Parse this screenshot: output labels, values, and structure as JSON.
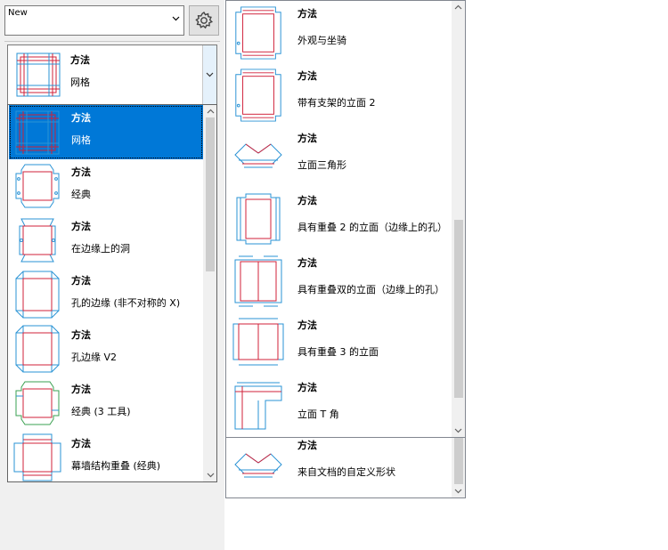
{
  "top_combo": {
    "value": "New"
  },
  "method_combo": {
    "title": "方法",
    "subtitle": "网格",
    "icon": "grid-method-thumbnail"
  },
  "dropdown": {
    "items": [
      {
        "title": "方法",
        "subtitle": "网格",
        "icon": "grid-method-thumbnail",
        "selected": true
      },
      {
        "title": "方法",
        "subtitle": "经典",
        "icon": "classic-method-thumbnail"
      },
      {
        "title": "方法",
        "subtitle": "在边缘上的洞",
        "icon": "hole-on-edge-thumbnail"
      },
      {
        "title": "方法",
        "subtitle": "孔的边缘 (非不对称的 X)",
        "icon": "hole-edge-thumbnail"
      },
      {
        "title": "方法",
        "subtitle": "孔边缘 V2",
        "icon": "hole-edge-v2-thumbnail"
      },
      {
        "title": "方法",
        "subtitle": "经典 (3 工具)",
        "icon": "classic-3-tools-thumbnail"
      },
      {
        "title": "方法",
        "subtitle": "幕墙结构重叠 (经典)",
        "icon": "curtain-overlap-thumbnail"
      }
    ]
  },
  "right_list": {
    "items": [
      {
        "title": "方法",
        "subtitle": "外观与坐骑",
        "icon": "appearance-mount-thumbnail"
      },
      {
        "title": "方法",
        "subtitle": "带有支架的立面 2",
        "icon": "facade-bracket-thumbnail"
      },
      {
        "title": "方法",
        "subtitle": "立面三角形",
        "icon": "facade-triangle-thumbnail"
      },
      {
        "title": "方法",
        "subtitle": "具有重叠 2 的立面（边缘上的孔）",
        "icon": "overlap-2-thumbnail"
      },
      {
        "title": "方法",
        "subtitle": "具有重叠双的立面（边缘上的孔）",
        "icon": "overlap-double-thumbnail"
      },
      {
        "title": "方法",
        "subtitle": "具有重叠 3 的立面",
        "icon": "overlap-3-thumbnail"
      },
      {
        "title": "方法",
        "subtitle": "立面 T 角",
        "icon": "t-corner-thumbnail"
      }
    ]
  },
  "bottom_list": {
    "item": {
      "title": "方法",
      "subtitle": "来自文档的自定义形状",
      "icon": "custom-shape-thumbnail"
    }
  },
  "colors": {
    "selection": "#0078d7",
    "cut_line": "#d0223a",
    "fold_line": "#2a93d5"
  }
}
